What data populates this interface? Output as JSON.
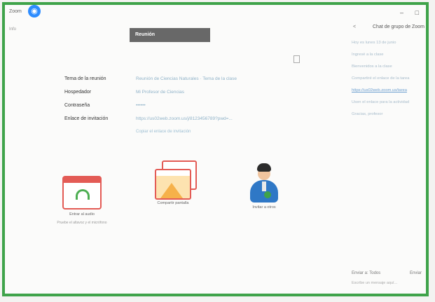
{
  "window": {
    "title": "Zoom",
    "menu_item": "Info",
    "controls": [
      "–",
      "□"
    ]
  },
  "banner": {
    "text": "Reunión"
  },
  "meeting_info": {
    "rows": [
      {
        "label": "Tema de la reunión",
        "value": "Reunión de Ciencias Naturales · Tema de la clase"
      },
      {
        "label": "Hospedador",
        "value": "Mi Profesor de Ciencias"
      },
      {
        "label": "Contraseña",
        "value": "••••••"
      },
      {
        "label": "Enlace de invitación",
        "value": "https://us02web.zoom.us/j/8123456789?pwd=..."
      }
    ],
    "copy_link": "Copiar el enlace de invitación"
  },
  "tiles": [
    {
      "label": "Entrar al audio",
      "sub": "Pruebe el altavoz y el micrófono"
    },
    {
      "label": "Compartir pantalla",
      "sub": ""
    },
    {
      "label": "Invitar a otros",
      "sub": ""
    }
  ],
  "chat": {
    "back": "<",
    "title": "Chat de grupo de Zoom",
    "messages": [
      {
        "text": "Hoy es lunes 13 de junio",
        "link": false
      },
      {
        "text": "Ingresé a la clase",
        "link": false
      },
      {
        "text": "Bienvenidos a la clase",
        "link": false
      },
      {
        "text": "Compartiré el enlace de la tarea",
        "link": false
      },
      {
        "text": "https://us02web.zoom.us/tarea",
        "link": true
      },
      {
        "text": "Usen el enlace para la actividad",
        "link": false
      },
      {
        "text": "Gracias, profesor",
        "link": false
      }
    ],
    "input_label": "Enviar a: Todos",
    "send_label": "Enviar",
    "note": "Escribe un mensaje aquí..."
  },
  "colors": {
    "frame": "#3fa34a",
    "accent": "#e35b55",
    "link": "#6d9fcf"
  }
}
